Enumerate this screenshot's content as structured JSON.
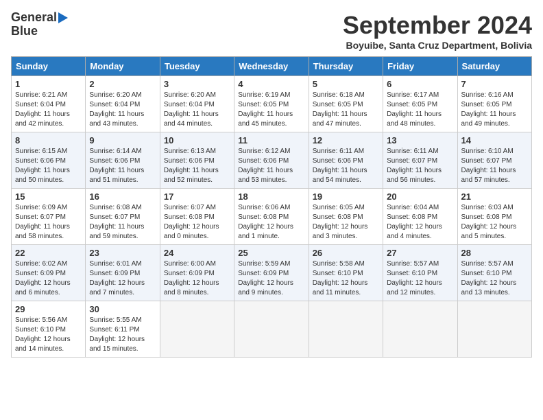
{
  "header": {
    "logo_line1": "General",
    "logo_line2": "Blue",
    "month": "September 2024",
    "location": "Boyuibe, Santa Cruz Department, Bolivia"
  },
  "weekdays": [
    "Sunday",
    "Monday",
    "Tuesday",
    "Wednesday",
    "Thursday",
    "Friday",
    "Saturday"
  ],
  "weeks": [
    [
      {
        "day": "1",
        "sunrise": "6:21 AM",
        "sunset": "6:04 PM",
        "daylight": "11 hours and 42 minutes."
      },
      {
        "day": "2",
        "sunrise": "6:20 AM",
        "sunset": "6:04 PM",
        "daylight": "11 hours and 43 minutes."
      },
      {
        "day": "3",
        "sunrise": "6:20 AM",
        "sunset": "6:04 PM",
        "daylight": "11 hours and 44 minutes."
      },
      {
        "day": "4",
        "sunrise": "6:19 AM",
        "sunset": "6:05 PM",
        "daylight": "11 hours and 45 minutes."
      },
      {
        "day": "5",
        "sunrise": "6:18 AM",
        "sunset": "6:05 PM",
        "daylight": "11 hours and 47 minutes."
      },
      {
        "day": "6",
        "sunrise": "6:17 AM",
        "sunset": "6:05 PM",
        "daylight": "11 hours and 48 minutes."
      },
      {
        "day": "7",
        "sunrise": "6:16 AM",
        "sunset": "6:05 PM",
        "daylight": "11 hours and 49 minutes."
      }
    ],
    [
      {
        "day": "8",
        "sunrise": "6:15 AM",
        "sunset": "6:06 PM",
        "daylight": "11 hours and 50 minutes."
      },
      {
        "day": "9",
        "sunrise": "6:14 AM",
        "sunset": "6:06 PM",
        "daylight": "11 hours and 51 minutes."
      },
      {
        "day": "10",
        "sunrise": "6:13 AM",
        "sunset": "6:06 PM",
        "daylight": "11 hours and 52 minutes."
      },
      {
        "day": "11",
        "sunrise": "6:12 AM",
        "sunset": "6:06 PM",
        "daylight": "11 hours and 53 minutes."
      },
      {
        "day": "12",
        "sunrise": "6:11 AM",
        "sunset": "6:06 PM",
        "daylight": "11 hours and 54 minutes."
      },
      {
        "day": "13",
        "sunrise": "6:11 AM",
        "sunset": "6:07 PM",
        "daylight": "11 hours and 56 minutes."
      },
      {
        "day": "14",
        "sunrise": "6:10 AM",
        "sunset": "6:07 PM",
        "daylight": "11 hours and 57 minutes."
      }
    ],
    [
      {
        "day": "15",
        "sunrise": "6:09 AM",
        "sunset": "6:07 PM",
        "daylight": "11 hours and 58 minutes."
      },
      {
        "day": "16",
        "sunrise": "6:08 AM",
        "sunset": "6:07 PM",
        "daylight": "11 hours and 59 minutes."
      },
      {
        "day": "17",
        "sunrise": "6:07 AM",
        "sunset": "6:08 PM",
        "daylight": "12 hours and 0 minutes."
      },
      {
        "day": "18",
        "sunrise": "6:06 AM",
        "sunset": "6:08 PM",
        "daylight": "12 hours and 1 minute."
      },
      {
        "day": "19",
        "sunrise": "6:05 AM",
        "sunset": "6:08 PM",
        "daylight": "12 hours and 3 minutes."
      },
      {
        "day": "20",
        "sunrise": "6:04 AM",
        "sunset": "6:08 PM",
        "daylight": "12 hours and 4 minutes."
      },
      {
        "day": "21",
        "sunrise": "6:03 AM",
        "sunset": "6:08 PM",
        "daylight": "12 hours and 5 minutes."
      }
    ],
    [
      {
        "day": "22",
        "sunrise": "6:02 AM",
        "sunset": "6:09 PM",
        "daylight": "12 hours and 6 minutes."
      },
      {
        "day": "23",
        "sunrise": "6:01 AM",
        "sunset": "6:09 PM",
        "daylight": "12 hours and 7 minutes."
      },
      {
        "day": "24",
        "sunrise": "6:00 AM",
        "sunset": "6:09 PM",
        "daylight": "12 hours and 8 minutes."
      },
      {
        "day": "25",
        "sunrise": "5:59 AM",
        "sunset": "6:09 PM",
        "daylight": "12 hours and 9 minutes."
      },
      {
        "day": "26",
        "sunrise": "5:58 AM",
        "sunset": "6:10 PM",
        "daylight": "12 hours and 11 minutes."
      },
      {
        "day": "27",
        "sunrise": "5:57 AM",
        "sunset": "6:10 PM",
        "daylight": "12 hours and 12 minutes."
      },
      {
        "day": "28",
        "sunrise": "5:57 AM",
        "sunset": "6:10 PM",
        "daylight": "12 hours and 13 minutes."
      }
    ],
    [
      {
        "day": "29",
        "sunrise": "5:56 AM",
        "sunset": "6:10 PM",
        "daylight": "12 hours and 14 minutes."
      },
      {
        "day": "30",
        "sunrise": "5:55 AM",
        "sunset": "6:11 PM",
        "daylight": "12 hours and 15 minutes."
      },
      null,
      null,
      null,
      null,
      null
    ]
  ]
}
